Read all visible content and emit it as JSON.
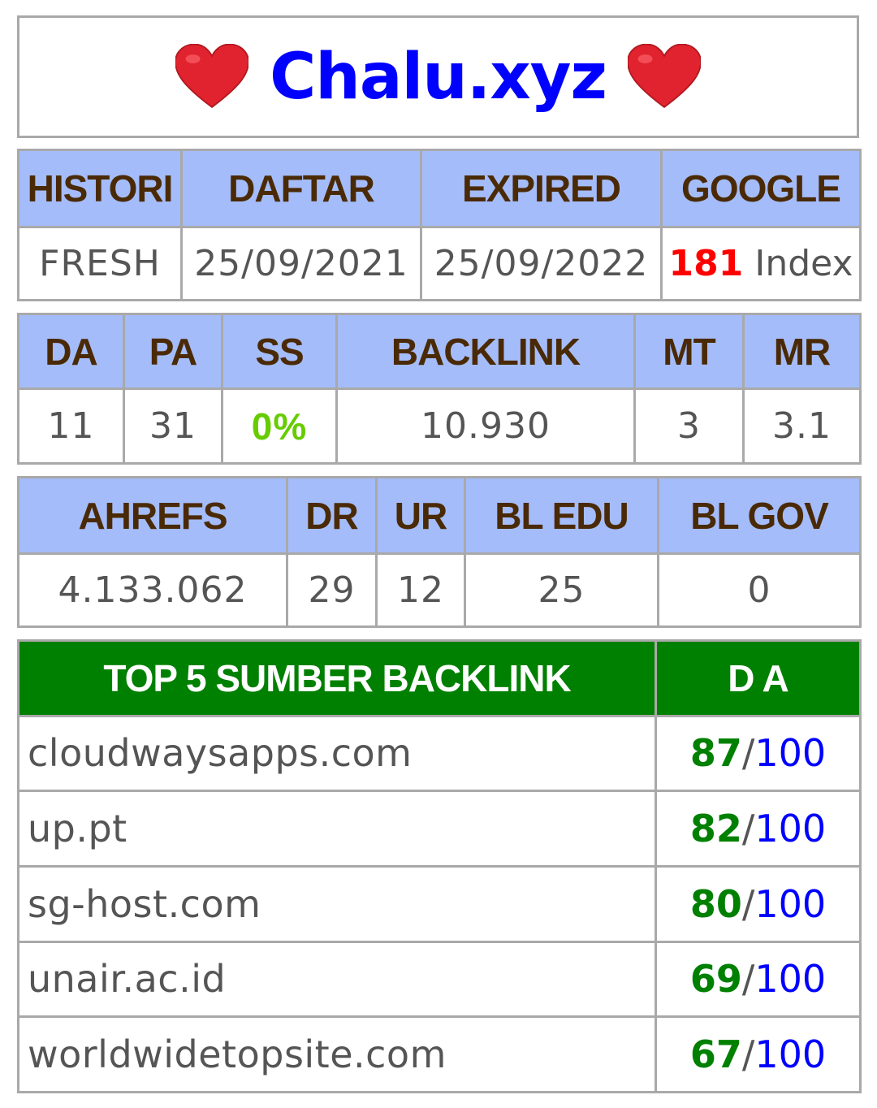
{
  "title": "Chalu.xyz",
  "colors": {
    "title": "#0000ff",
    "header_bg": "#a4bcfa",
    "header_text": "#4a2a06",
    "green_header": "#008000",
    "index_red": "#ff0000",
    "ss_green": "#66cc00",
    "da_max_blue": "#0000ff"
  },
  "info": {
    "headers": {
      "histori": "HISTORI",
      "daftar": "DAFTAR",
      "expired": "EXPIRED",
      "google": "GOOGLE"
    },
    "histori": "FRESH",
    "daftar": "25/09/2021",
    "expired": "25/09/2022",
    "google_count": "181",
    "google_suffix": "Index"
  },
  "metrics": {
    "headers": {
      "da": "DA",
      "pa": "PA",
      "ss": "SS",
      "backlink": "BACKLINK",
      "mt": "MT",
      "mr": "MR"
    },
    "da": "11",
    "pa": "31",
    "ss": "0%",
    "backlink": "10.930",
    "mt": "3",
    "mr": "3.1"
  },
  "ahrefs": {
    "headers": {
      "ahrefs": "AHREFS",
      "dr": "DR",
      "ur": "UR",
      "bl_edu": "BL EDU",
      "bl_gov": "BL GOV"
    },
    "ahrefs": "4.133.062",
    "dr": "29",
    "ur": "12",
    "bl_edu": "25",
    "bl_gov": "0"
  },
  "top_backlinks": {
    "headers": {
      "source": "TOP 5 SUMBER BACKLINK",
      "da": "D A"
    },
    "separator": "/",
    "rows": [
      {
        "site": "cloudwaysapps.com",
        "da": "87",
        "max": "100"
      },
      {
        "site": "up.pt",
        "da": "82",
        "max": "100"
      },
      {
        "site": "sg-host.com",
        "da": "80",
        "max": "100"
      },
      {
        "site": "unair.ac.id",
        "da": "69",
        "max": "100"
      },
      {
        "site": "worldwidetopsite.com",
        "da": "67",
        "max": "100"
      }
    ]
  }
}
